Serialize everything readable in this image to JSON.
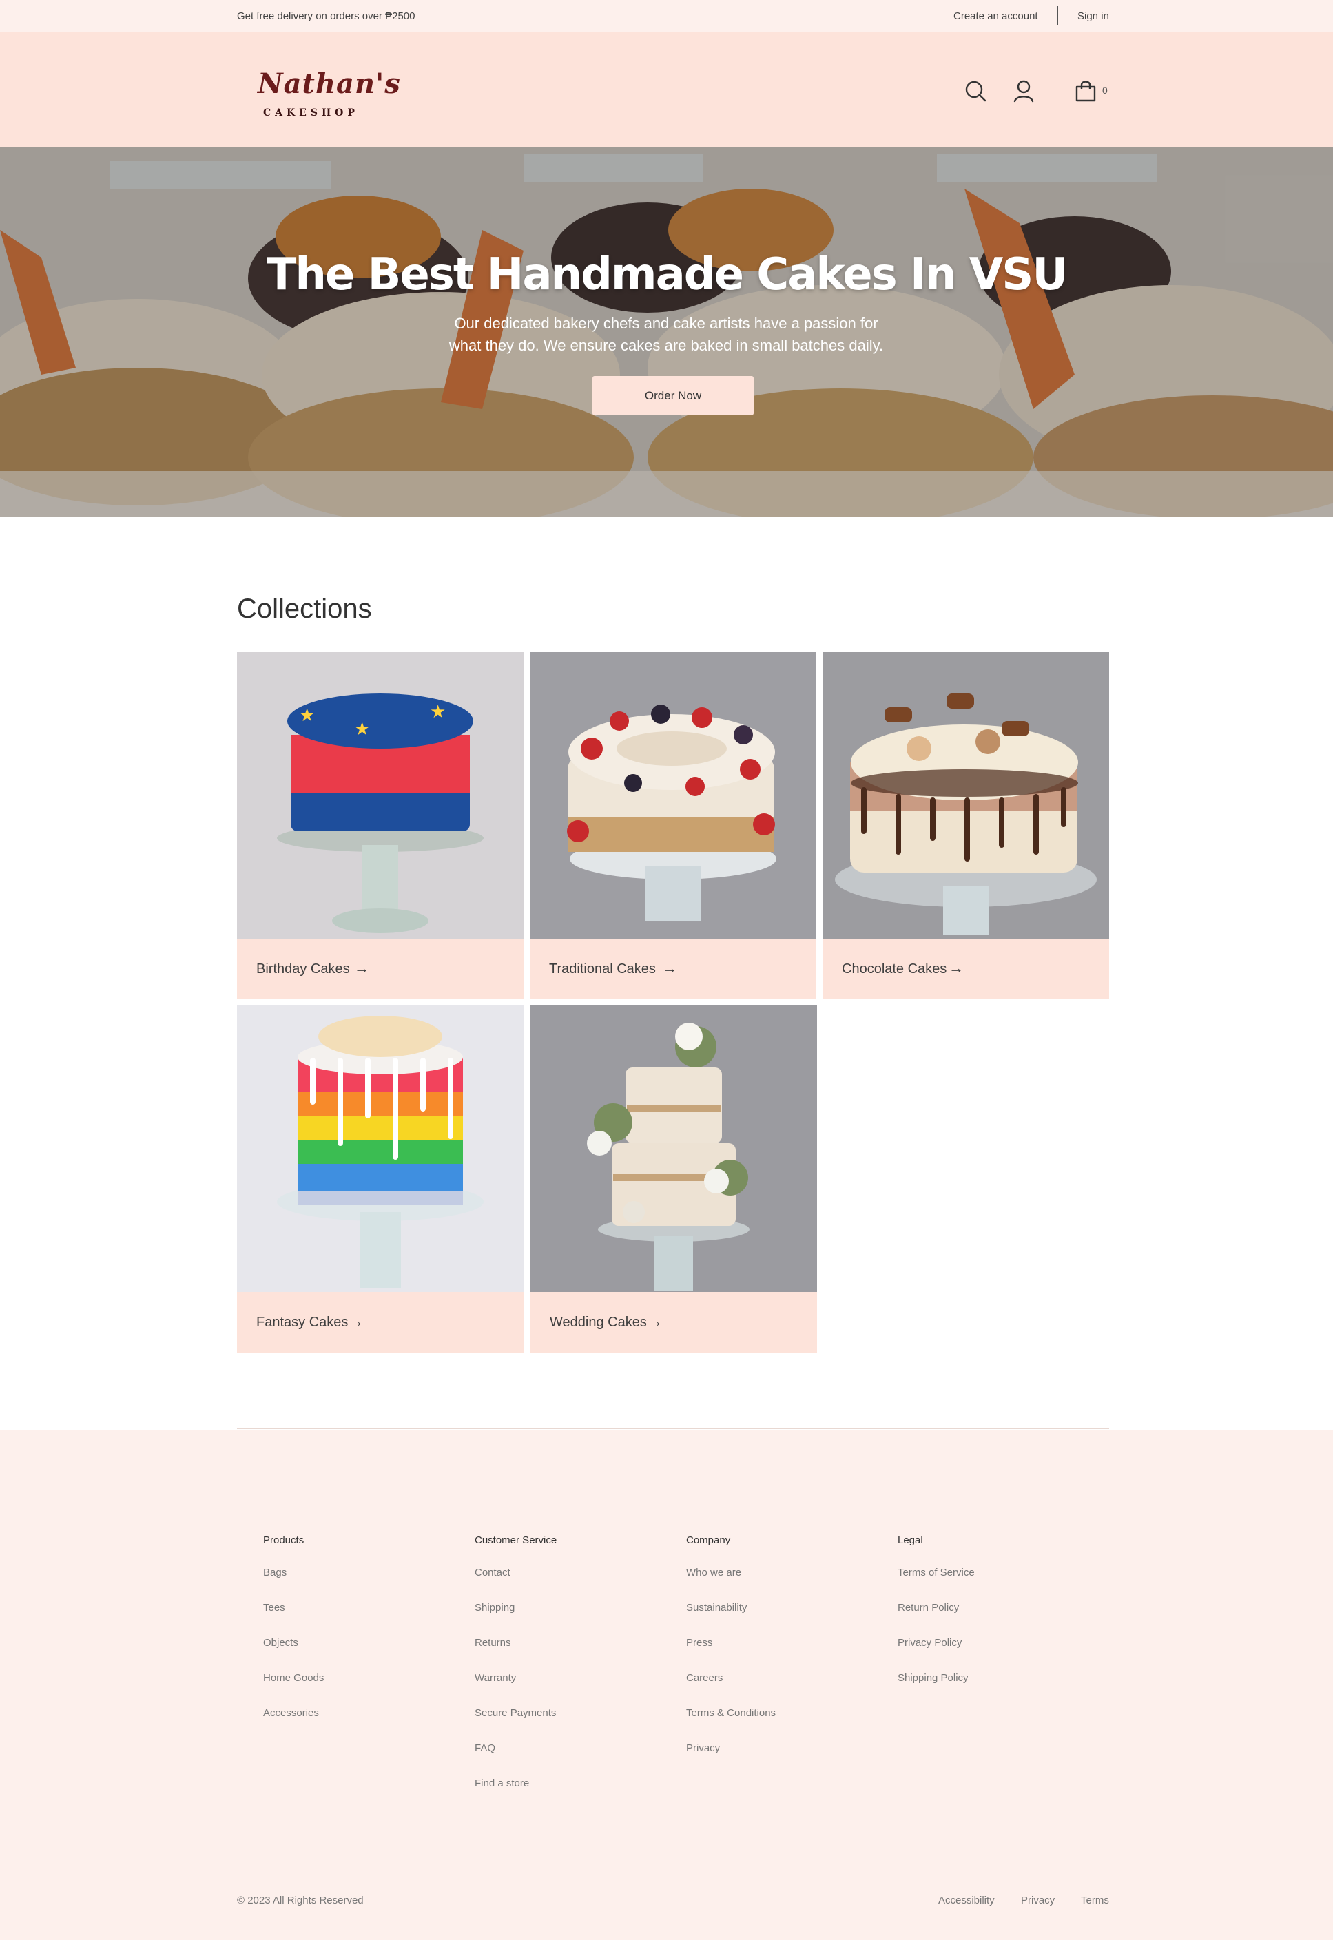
{
  "topbar": {
    "promo": "Get free delivery on orders over ₱2500",
    "create_account": "Create an account",
    "sign_in": "Sign in"
  },
  "header": {
    "logo_name": "Nathan's",
    "logo_sub": "CAKESHOP",
    "cart_count": "0",
    "icons": [
      "search-icon",
      "user-icon",
      "shopping-bag-icon"
    ]
  },
  "hero": {
    "title": "The Best Handmade Cakes In VSU",
    "subtitle": "Our dedicated bakery chefs and cake artists have a passion for what they do. We ensure cakes are baked in small batches daily.",
    "button": "Order Now"
  },
  "collections": {
    "title": "Collections",
    "items": [
      {
        "label": "Birthday Cakes",
        "arrow": "→"
      },
      {
        "label": "Traditional Cakes",
        "arrow": "→"
      },
      {
        "label": "Chocolate Cakes",
        "arrow": "→"
      },
      {
        "label": "Fantasy Cakes",
        "arrow": "→"
      },
      {
        "label": "Wedding Cakes",
        "arrow": "→"
      }
    ]
  },
  "footer": {
    "columns": [
      {
        "title": "Products",
        "links": [
          "Bags",
          "Tees",
          "Objects",
          "Home Goods",
          "Accessories"
        ]
      },
      {
        "title": "Customer Service",
        "links": [
          "Contact",
          "Shipping",
          "Returns",
          "Warranty",
          "Secure Payments",
          "FAQ",
          "Find a store"
        ]
      },
      {
        "title": "Company",
        "links": [
          "Who we are",
          "Sustainability",
          "Press",
          "Careers",
          "Terms & Conditions",
          "Privacy"
        ]
      },
      {
        "title": "Legal",
        "links": [
          "Terms of Service",
          "Return Policy",
          "Privacy Policy",
          "Shipping Policy"
        ]
      }
    ],
    "copyright": "© 2023 All Rights Reserved",
    "bottom_links": [
      "Accessibility",
      "Privacy",
      "Terms"
    ]
  },
  "colors": {
    "header_bg": "#fde3da",
    "topbar_bg": "#fdf0ec",
    "accent": "#fde3da",
    "logo": "#6b1c1c"
  }
}
